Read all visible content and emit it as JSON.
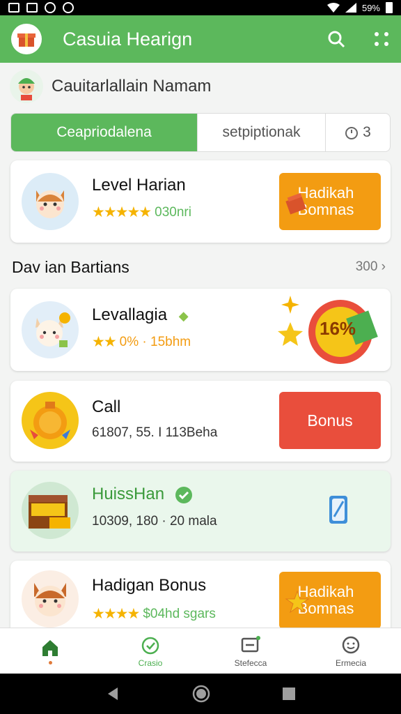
{
  "status_bar": {
    "battery": "59%"
  },
  "app_bar": {
    "title": "Casuia Hearign"
  },
  "user": {
    "name": "Cauitarlallain Namam"
  },
  "tabs": [
    {
      "label": "Ceapriodalena"
    },
    {
      "label": "setpiptionak"
    },
    {
      "label": "3"
    }
  ],
  "top_card": {
    "title": "Level Harian",
    "stars": "★★★★★",
    "meta": "030nri",
    "button": "Hadikah Bomnas"
  },
  "section": {
    "title": "Dav ian Bartians",
    "link": "300"
  },
  "items": [
    {
      "title": "Levallagia",
      "stars": "★★",
      "meta": "0% · 15bhm",
      "badge": "16%"
    },
    {
      "title": "Call",
      "meta": "61807, 55. I 113Beha",
      "button": "Bonus"
    },
    {
      "title": "HuissHan",
      "meta": "10309, 180 · 20 mala"
    },
    {
      "title": "Hadigan Bonus",
      "stars": "★★★★",
      "meta": "$04hd sgars",
      "button": "Hadikah Bomnas"
    }
  ],
  "bottom_nav": [
    {
      "label": ""
    },
    {
      "label": "Crasio"
    },
    {
      "label": "Stefecca"
    },
    {
      "label": "Ermecia"
    }
  ],
  "colors": {
    "primary": "#5cb85c",
    "orange": "#f39c12",
    "red": "#e94e3c"
  }
}
